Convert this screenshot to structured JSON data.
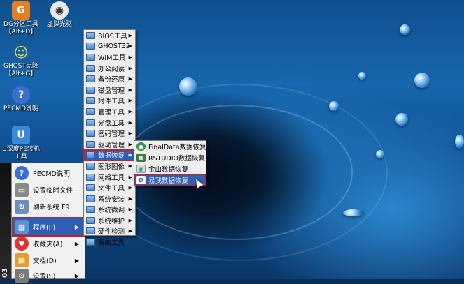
{
  "desktop": {
    "icons": [
      {
        "label_1": "DG分区工具",
        "label_2": "【Alt+D】"
      },
      {
        "label_1": "虚拟光驱",
        "label_2": ""
      },
      {
        "label_1": "GHOST克隆",
        "label_2": "【Alt+G】"
      },
      {
        "label_1": "PECMD说明",
        "label_2": ""
      },
      {
        "label_1": "U深度PE装机",
        "label_2": "工具"
      }
    ]
  },
  "start_strip": {
    "text": "03"
  },
  "start_menu": {
    "items": [
      {
        "label": "PECMD说明"
      },
      {
        "label": "设置临时文件"
      },
      {
        "label": "刷新系统 F9"
      },
      {
        "label": "程序(P)",
        "arrow": "▶"
      },
      {
        "label": "收藏夹(A)",
        "arrow": "▶"
      },
      {
        "label": "文档(D)",
        "arrow": "▶"
      },
      {
        "label": "设置(S)",
        "arrow": "▶"
      }
    ]
  },
  "programs_menu": {
    "arrow": "▶",
    "items": [
      {
        "label": "BIOS工具"
      },
      {
        "label": "GHOST32"
      },
      {
        "label": "WIM工具"
      },
      {
        "label": "办公阅读"
      },
      {
        "label": "备份还原"
      },
      {
        "label": "磁盘管理"
      },
      {
        "label": "附件工具"
      },
      {
        "label": "管理工具"
      },
      {
        "label": "光盘工具"
      },
      {
        "label": "密码管理"
      },
      {
        "label": "驱动管理"
      },
      {
        "label": "数据恢复"
      },
      {
        "label": "图形图像"
      },
      {
        "label": "网络工具"
      },
      {
        "label": "文件工具"
      },
      {
        "label": "系统安装"
      },
      {
        "label": "系统微调"
      },
      {
        "label": "系统维护"
      },
      {
        "label": "硬件检测"
      },
      {
        "label": "我的工具"
      }
    ]
  },
  "recovery_menu": {
    "items": [
      {
        "label": "FinalData数据恢复"
      },
      {
        "label": "RSTUDIO数据恢复"
      },
      {
        "label": "金山数据恢复"
      },
      {
        "label": "易我数据恢复"
      }
    ]
  },
  "colors": {
    "highlight": "#2d5fb3",
    "highlight_border": "#c81e2a"
  }
}
